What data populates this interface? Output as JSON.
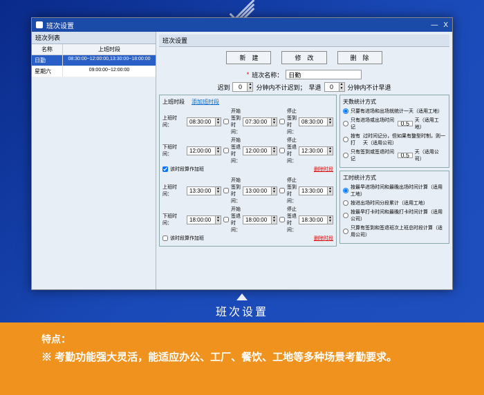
{
  "window": {
    "title": "班次设置",
    "min": "—",
    "close": "X"
  },
  "leftPane": {
    "header": "班次列表",
    "th1": "名称",
    "th2": "上班时段",
    "rows": [
      {
        "name": "日勤",
        "period": "08:30:00~12:00:00,13:30:00~18:00:00"
      },
      {
        "name": "星期六",
        "period": "09:00:00~12:00:00"
      }
    ]
  },
  "rightPane": {
    "header": "班次设置"
  },
  "buttons": {
    "new": "新　建",
    "edit": "修　改",
    "del": "删　除"
  },
  "form": {
    "nameLabel": "班次名称：",
    "nameVal": "日勤",
    "lateLabel": "迟到",
    "lateVal": "0",
    "lateUnit": "分钟内不计迟到；",
    "earlyLabel": "早退",
    "earlyVal": "0",
    "earlyUnit": "分钟内不计早退"
  },
  "timeGrp": {
    "hdr": "上班时段",
    "add": "添加班时段",
    "del": "删除时段",
    "onLabel": "上班时间：",
    "offLabel": "下班时间：",
    "startChk": "开始签到时间：",
    "endChk": "停止签到时间：",
    "startOut": "开始签退时间：",
    "endOut": "停止签退时间：",
    "otFlag": "该时段算作加班",
    "seg1": {
      "on": "08:30:00",
      "startIn": "07:30:00",
      "endIn": "08:30:00",
      "off": "12:00:00",
      "startOut": "12:00:00",
      "endOut": "12:30:00"
    },
    "seg2": {
      "on": "13:30:00",
      "startIn": "13:00:00",
      "endIn": "13:30:00",
      "off": "18:00:00",
      "startOut": "18:00:00",
      "endOut": "18:30:00"
    }
  },
  "dayCount": {
    "hdr": "天数统计方式",
    "r1": "只要有进场和出场就统计一天（适用工地）",
    "r2a": "只有进场或出场时间记",
    "r2v": "0.5",
    "r2b": "天（适用工地）",
    "r3a": "按有打",
    "r3m": "过时间记分，但如果有整型时制，则一天（适用公司）",
    "r4a": "只有签到或签退时间记",
    "r4v": "0.5",
    "r4b": "天（适用公司）"
  },
  "workCalc": {
    "hdr": "工时统计方式",
    "r1": "按最早进场时间和最晚出场时间计算（适用工地）",
    "r2": "按进出场时间分段累计（适用工地）",
    "r3": "按最早打卡时间和最晚打卡时间计算（适用公司）",
    "r4": "只算有签到和签退班次上班总时段计算（适用公司）"
  },
  "caption": "班次设置",
  "feature": {
    "title": "特点：",
    "text": "※ 考勤功能强大灵活，能适应办公、工厂、餐饮、工地等多种场景考勤要求。"
  }
}
